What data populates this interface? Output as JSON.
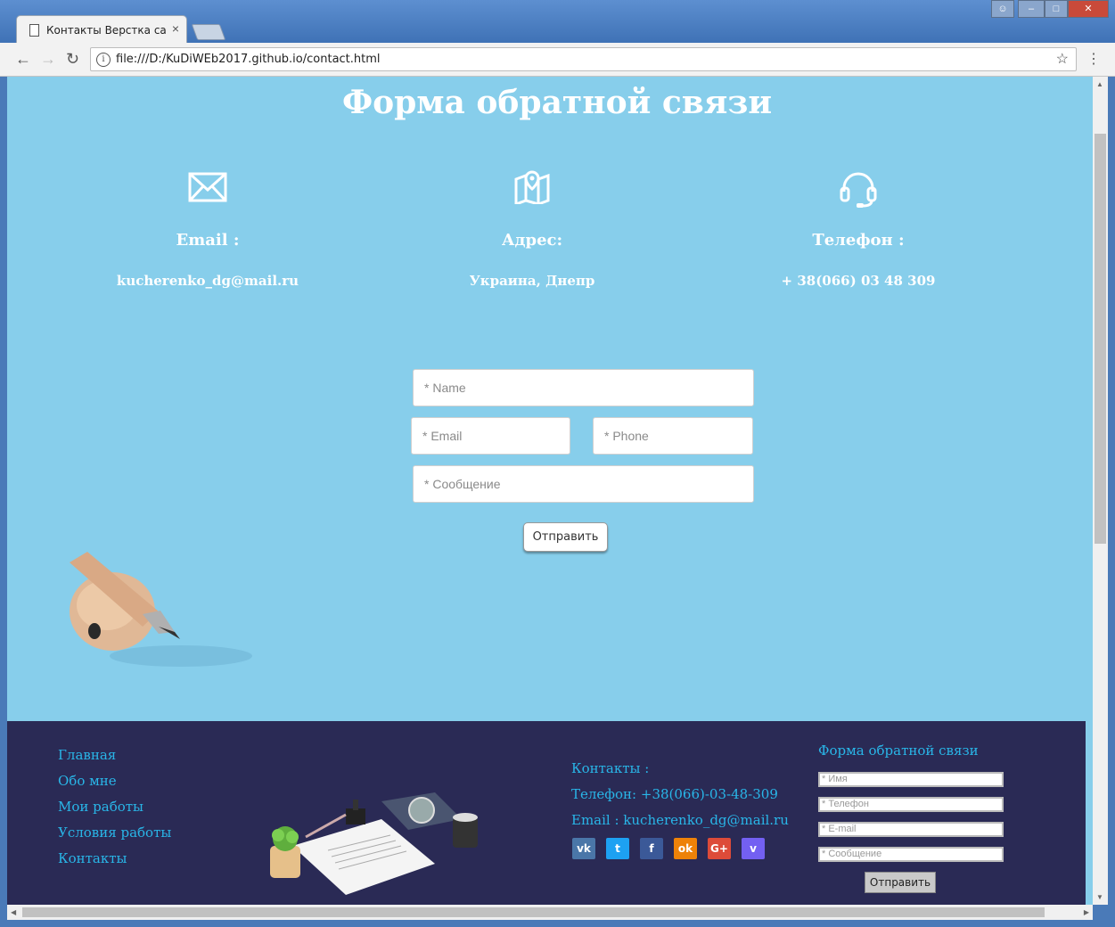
{
  "browser": {
    "tab_title": "Контакты Верстка сайто",
    "tab_close": "×",
    "url": "file:///D:/KuDiWEb2017.github.io/contact.html"
  },
  "page": {
    "title": "Форма обратной связи",
    "info": [
      {
        "label": "Email :",
        "value": "kucherenko_dg@mail.ru",
        "icon": "envelope-icon"
      },
      {
        "label": "Адрес:",
        "value": "Украина, Днепр",
        "icon": "map-icon"
      },
      {
        "label": "Телефон :",
        "value": "+ 38(066) 03 48 309",
        "icon": "headset-icon"
      }
    ],
    "form": {
      "name_placeholder": "* Name",
      "email_placeholder": "* Email",
      "phone_placeholder": "* Phone",
      "message_placeholder": "* Сообщение",
      "submit_label": "Отправить"
    }
  },
  "footer": {
    "nav": [
      "Главная",
      "Обо мне",
      "Мои работы",
      "Условия работы",
      "Контакты"
    ],
    "contacts": {
      "heading": "Контакты :",
      "phone": "Телефон: +38(066)-03-48-309",
      "email": "Email : kucherenko_dg@mail.ru"
    },
    "social": [
      {
        "name": "vk",
        "glyph": "vk",
        "color": "#4a76a8"
      },
      {
        "name": "twitter",
        "glyph": "t",
        "color": "#1da1f2"
      },
      {
        "name": "facebook",
        "glyph": "f",
        "color": "#3b5998"
      },
      {
        "name": "odnoklassniki",
        "glyph": "ok",
        "color": "#ee8208"
      },
      {
        "name": "google-plus",
        "glyph": "G+",
        "color": "#dd4b39"
      },
      {
        "name": "viber",
        "glyph": "v",
        "color": "#7360f2"
      }
    ],
    "form": {
      "title": "Форма обратной связи",
      "name_placeholder": "* Имя",
      "phone_placeholder": "* Телефон",
      "email_placeholder": "* E-mail",
      "message_placeholder": "* Сообщение",
      "submit_label": "Отправить"
    }
  },
  "colors": {
    "page_bg": "#87ceeb",
    "footer_bg": "#2a2a55",
    "footer_link": "#29b6e8"
  }
}
